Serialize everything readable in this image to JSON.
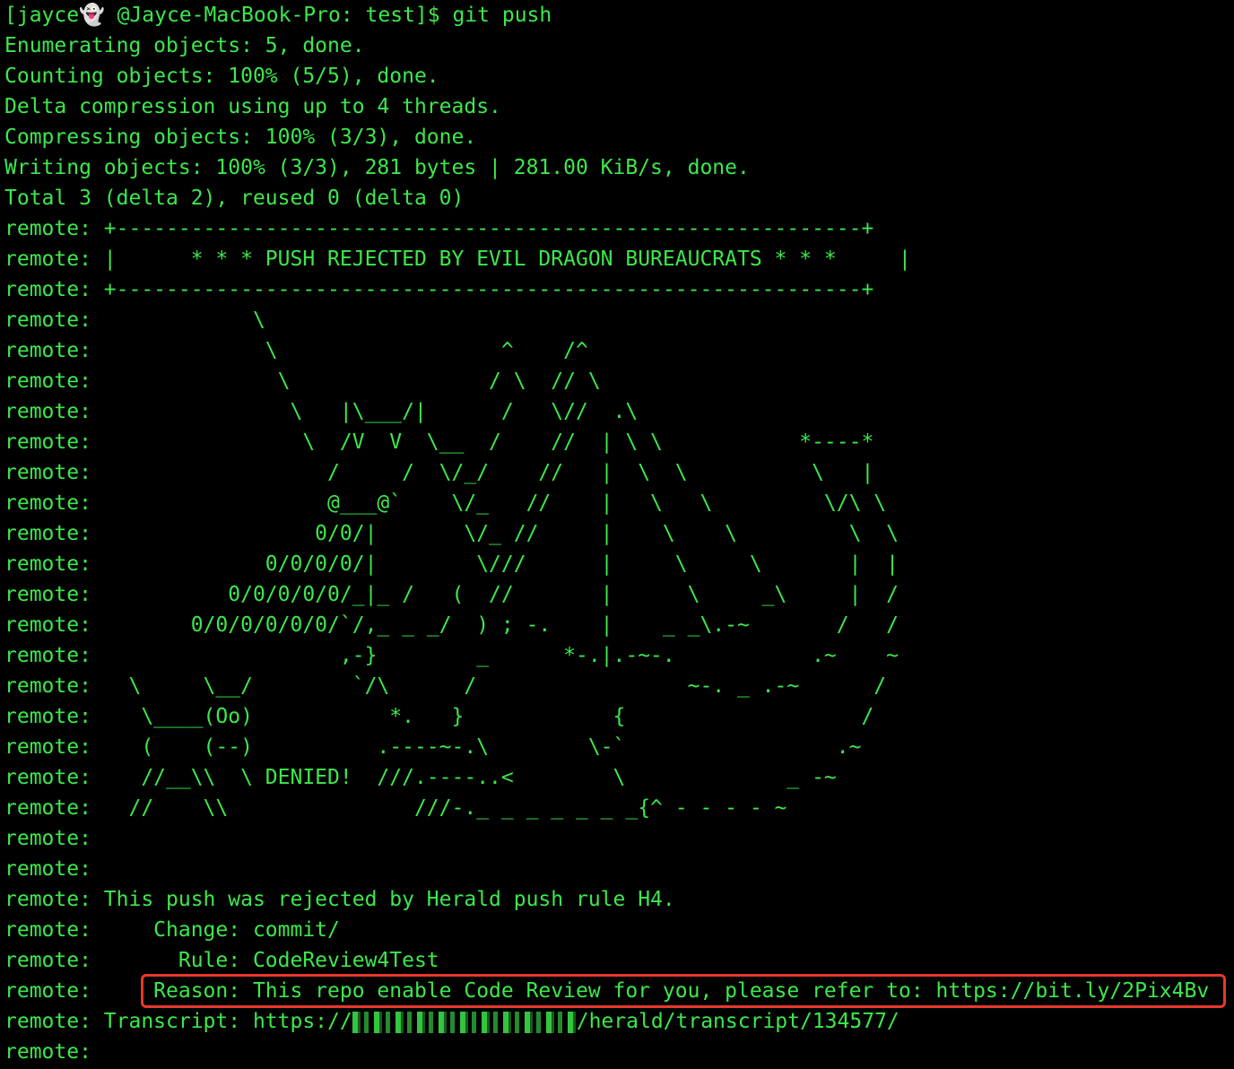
{
  "terminal": {
    "prompt": {
      "user_prefix": "[jayce",
      "ghost": "👻",
      "rest": " @Jayce-MacBook-Pro: test]$ git push"
    },
    "lines": [
      "Enumerating objects: 5, done.",
      "Counting objects: 100% (5/5), done.",
      "Delta compression using up to 4 threads.",
      "Compressing objects: 100% (3/3), done.",
      "Writing objects: 100% (3/3), 281 bytes | 281.00 KiB/s, done.",
      "Total 3 (delta 2), reused 0 (delta 0)",
      "remote: +------------------------------------------------------------+",
      "remote: |      * * * PUSH REJECTED BY EVIL DRAGON BUREAUCRATS * * *     |",
      "remote: +------------------------------------------------------------+",
      "remote:             \\",
      "remote:              \\                  ^    /^",
      "remote:               \\                / \\  // \\",
      "remote:                \\   |\\___/|      /   \\//  .\\",
      "remote:                 \\  /V  V  \\__  /    //  | \\ \\           *----*",
      "remote:                   /     /  \\/_/    //   |  \\  \\          \\   |",
      "remote:                   @___@`    \\/_   //    |   \\   \\         \\/\\ \\",
      "remote:                  0/0/|       \\/_ //     |    \\    \\         \\  \\",
      "remote:              0/0/0/0/|        \\///      |     \\     \\       |  |",
      "remote:           0/0/0/0/0/_|_ /   (  //       |      \\     _\\     |  /",
      "remote:        0/0/0/0/0/0/`/,_ _ _/  ) ; -.    |    _ _\\.-~       /   /",
      "remote:                    ,-}        _      *-.|.-~-.           .~    ~",
      "remote:   \\     \\__/        `/\\      /                 ~-. _ .-~      /",
      "remote:    \\____(Oo)           *.   }            {                   /",
      "remote:    (    (--)          .----~-.\\        \\-`                 .~",
      "remote:    //__\\\\  \\ DENIED!  ///.----..<        \\             _ -~",
      "remote:   //    \\\\               ///-._ _ _ _ _ _ _{^ - - - - ~",
      "remote:",
      "remote:",
      "remote: This push was rejected by Herald push rule H4.",
      "remote:     Change: commit/",
      "remote:       Rule: CodeReview4Test",
      "remote:     Reason: This repo enable Code Review for you, please refer to: https://bit.ly/2Pix4Bv"
    ],
    "transcript_prefix": "remote: Transcript: https://",
    "transcript_suffix": "/herald/transcript/134577/",
    "last_line": "remote:"
  },
  "colors": {
    "background": "#000000",
    "text": "#3ce84c",
    "highlight_border": "#e8392a"
  }
}
